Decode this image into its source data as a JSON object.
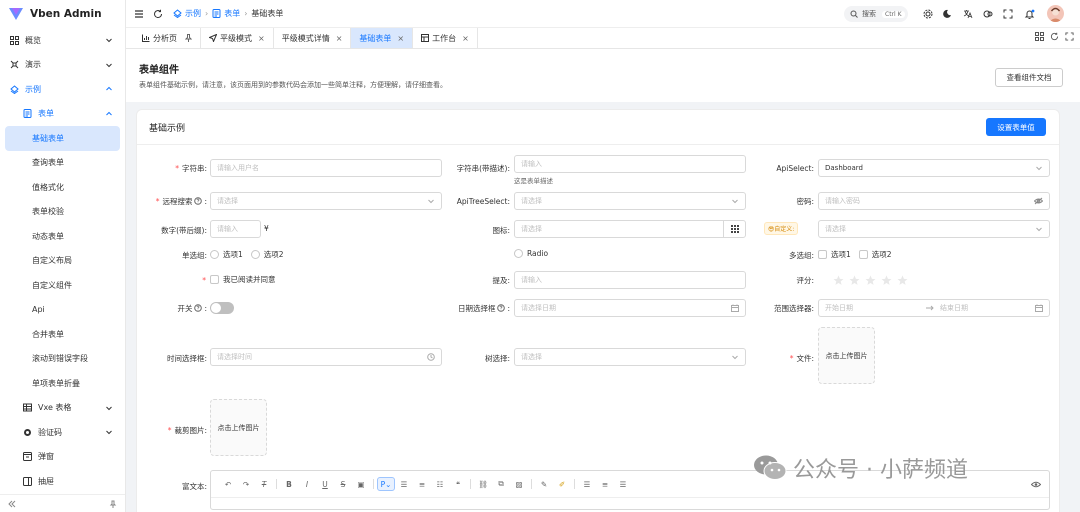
{
  "app": {
    "title": "Vben Admin"
  },
  "sidebar": {
    "items": [
      {
        "label": "概览",
        "icon": "grid-icon",
        "level": 1,
        "chevron": "down"
      },
      {
        "label": "演示",
        "icon": "spark-icon",
        "level": 1,
        "chevron": "down"
      },
      {
        "label": "示例",
        "icon": "example-icon",
        "level": 1,
        "chevron": "up",
        "active": true
      },
      {
        "label": "表单",
        "icon": "form-icon",
        "level": 2,
        "chevron": "up",
        "active": true
      },
      {
        "label": "基础表单",
        "level": 3,
        "selected": true
      },
      {
        "label": "查询表单",
        "level": 3
      },
      {
        "label": "值格式化",
        "level": 3
      },
      {
        "label": "表单校验",
        "level": 3
      },
      {
        "label": "动态表单",
        "level": 3
      },
      {
        "label": "自定义布局",
        "level": 3
      },
      {
        "label": "自定义组件",
        "level": 3
      },
      {
        "label": "Api",
        "level": 3
      },
      {
        "label": "合并表单",
        "level": 3
      },
      {
        "label": "滚动到错误字段",
        "level": 3
      },
      {
        "label": "单项表单折叠",
        "level": 3
      },
      {
        "label": "Vxe 表格",
        "icon": "table-icon",
        "level": 2,
        "chevron": "down"
      },
      {
        "label": "验证码",
        "icon": "captcha-icon",
        "level": 2,
        "chevron": "down"
      },
      {
        "label": "弹窗",
        "icon": "modal-icon",
        "level": 2
      },
      {
        "label": "抽屉",
        "icon": "drawer-icon",
        "level": 2
      }
    ]
  },
  "header": {
    "breadcrumb": [
      {
        "label": "示例",
        "icon": "example-icon"
      },
      {
        "label": "表单",
        "icon": "form-icon"
      },
      {
        "label": "基础表单"
      }
    ],
    "search_label": "搜索",
    "search_kbd": "Ctrl K"
  },
  "tabs": [
    {
      "label": "分析页",
      "icon": "chart-icon",
      "pinned": true
    },
    {
      "label": "平级模式",
      "icon": "send-icon"
    },
    {
      "label": "平级模式详情"
    },
    {
      "label": "基础表单",
      "active": true
    },
    {
      "label": "工作台",
      "icon": "workbench-icon"
    }
  ],
  "page": {
    "title": "表单组件",
    "desc": "表单组件基础示例，请注意，该页面用到的参数代码会添加一些简单注释，方便理解，请仔细查看。",
    "doc_button": "查看组件文档"
  },
  "card": {
    "title": "基础示例",
    "set_button": "设置表单值"
  },
  "form": {
    "username": {
      "label": "字符串:",
      "placeholder": "请输入用户名"
    },
    "desc_str": {
      "label": "字符串(带描述):",
      "placeholder": "请输入",
      "helper": "这是表单描述"
    },
    "api_select": {
      "label": "ApiSelect:",
      "value": "Dashboard"
    },
    "remote_search": {
      "label": "远程搜索",
      "placeholder": "请选择"
    },
    "api_tree": {
      "label": "ApiTreeSelect:",
      "placeholder": "请选择"
    },
    "password": {
      "label": "密码:",
      "placeholder": "请输入密码"
    },
    "number": {
      "label": "数字(带后缀):",
      "placeholder": "请输入",
      "suffix": "¥"
    },
    "icon": {
      "label": "图标:",
      "placeholder": "请选择"
    },
    "custom": {
      "tag": "😎自定义:",
      "placeholder": "请选择"
    },
    "radio_group": {
      "label": "单选组:",
      "options": [
        "选项1",
        "选项2"
      ]
    },
    "radio": {
      "option": "Radio"
    },
    "checkbox_group": {
      "label": "多选组:",
      "options": [
        "选项1",
        "选项2"
      ]
    },
    "agree": {
      "text": "我已阅读并同意"
    },
    "mention": {
      "label": "提及:",
      "placeholder": "请输入"
    },
    "rate": {
      "label": "评分:",
      "value": 0,
      "max": 5
    },
    "switch": {
      "label": "开关",
      "on": false
    },
    "date": {
      "label": "日期选择框",
      "placeholder": "请选择日期"
    },
    "range": {
      "label": "范围选择器:",
      "start": "开始日期",
      "end": "结束日期"
    },
    "time": {
      "label": "时间选择框:",
      "placeholder": "请选择时间"
    },
    "tree": {
      "label": "树选择:",
      "placeholder": "请选择"
    },
    "file": {
      "label": "文件:",
      "text": "点击上传图片"
    },
    "crop": {
      "label": "裁剪图片:",
      "text": "点击上传图片"
    },
    "richtext": {
      "label": "富文本:"
    }
  },
  "watermark": {
    "text": "公众号 · 小萨频道"
  },
  "colors": {
    "primary": "#1677ff",
    "selected_bg": "#d9e7fd",
    "required": "#ff4d4f"
  }
}
